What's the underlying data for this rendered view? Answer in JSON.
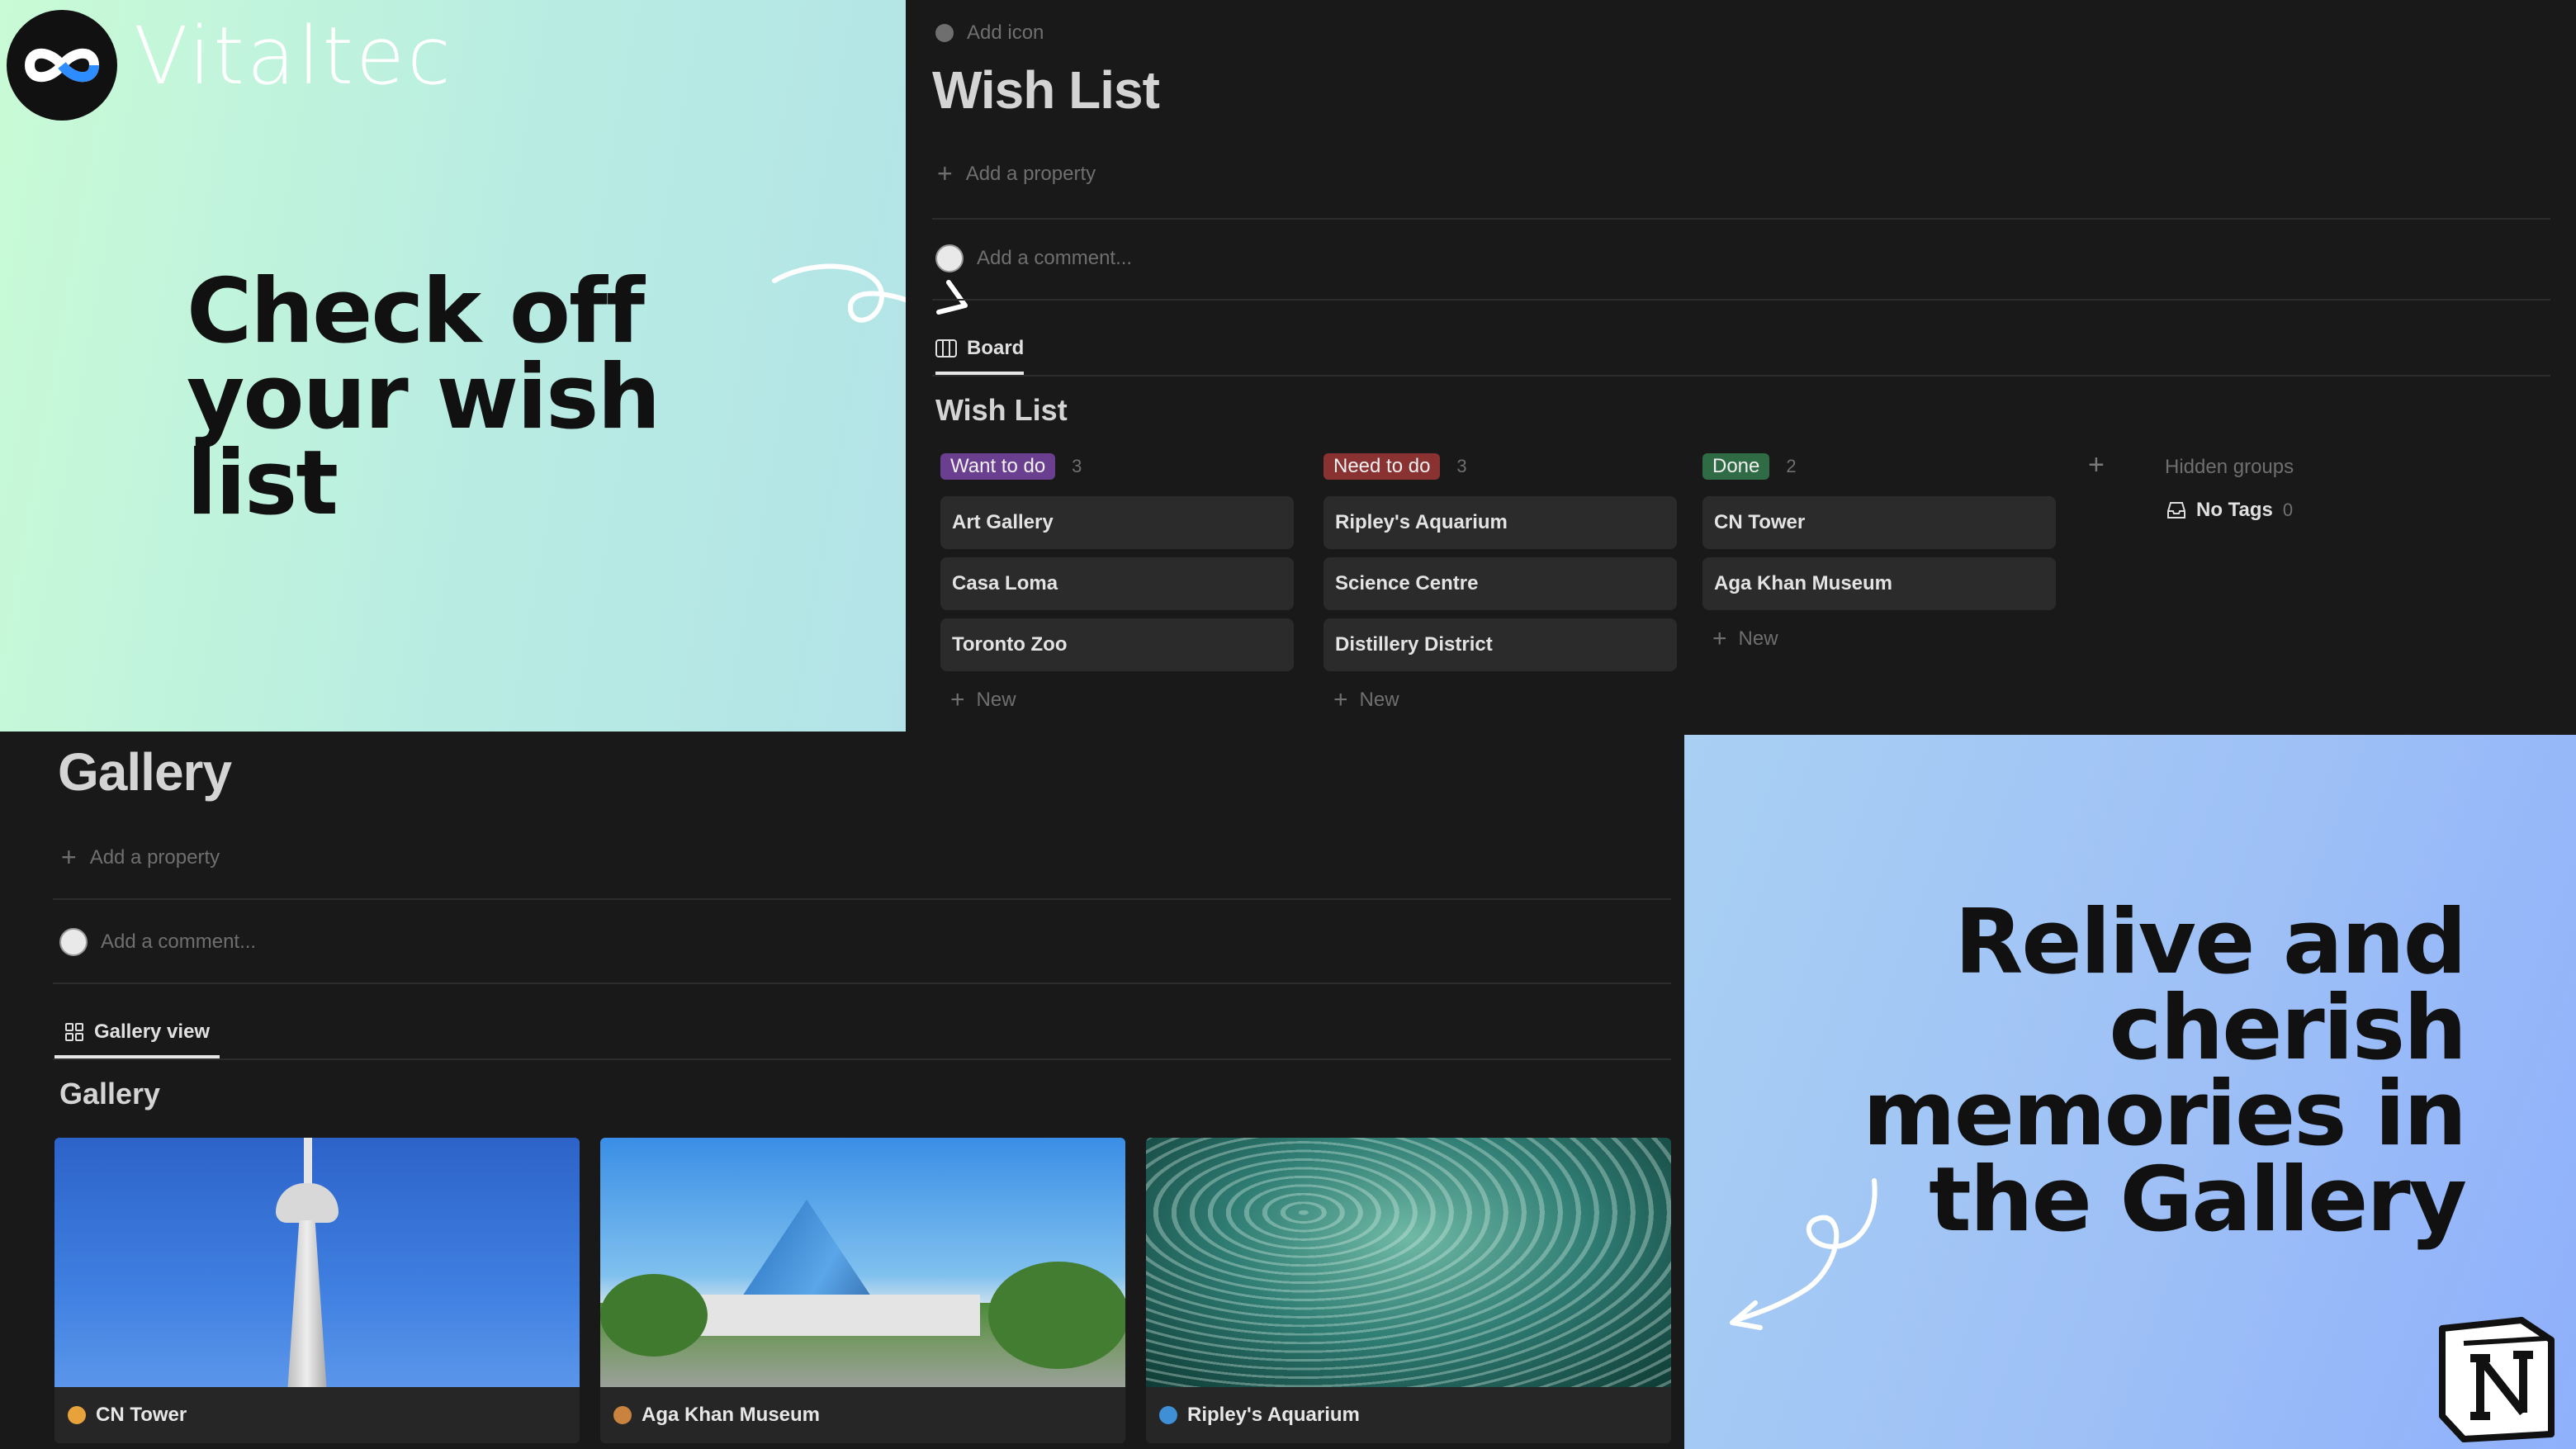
{
  "brand": {
    "name": "Vitaltec"
  },
  "promo_top": {
    "headline": "Check off your wish list"
  },
  "promo_bottom": {
    "headline": "Relive and cherish memories in the Gallery"
  },
  "wish_page": {
    "add_icon": "Add icon",
    "title": "Wish List",
    "add_property": "Add a property",
    "comment_placeholder": "Add a comment...",
    "view_tab": "Board",
    "view_title": "Wish List",
    "columns": [
      {
        "label": "Want to do",
        "count": "3",
        "color": "#6b3f8f",
        "items": [
          "Art Gallery",
          "Casa Loma",
          "Toronto Zoo"
        ],
        "new_label": "New"
      },
      {
        "label": "Need to do",
        "count": "3",
        "color": "#8a3232",
        "items": [
          "Ripley's Aquarium",
          "Science Centre",
          "Distillery District"
        ],
        "new_label": "New"
      },
      {
        "label": "Done",
        "count": "2",
        "color": "#2f6b45",
        "items": [
          "CN Tower",
          "Aga Khan Museum"
        ],
        "new_label": "New"
      }
    ],
    "hidden_groups": {
      "label": "Hidden groups",
      "no_tags": "No Tags",
      "count": "0"
    }
  },
  "gallery_page": {
    "title": "Gallery",
    "add_property": "Add a property",
    "comment_placeholder": "Add a comment...",
    "view_tab": "Gallery view",
    "view_title": "Gallery",
    "cards": [
      {
        "title": "CN Tower",
        "icon": "tower-emoji-icon"
      },
      {
        "title": "Aga Khan Museum",
        "icon": "palette-emoji-icon"
      },
      {
        "title": "Ripley's Aquarium",
        "icon": "fish-emoji-icon"
      }
    ]
  }
}
